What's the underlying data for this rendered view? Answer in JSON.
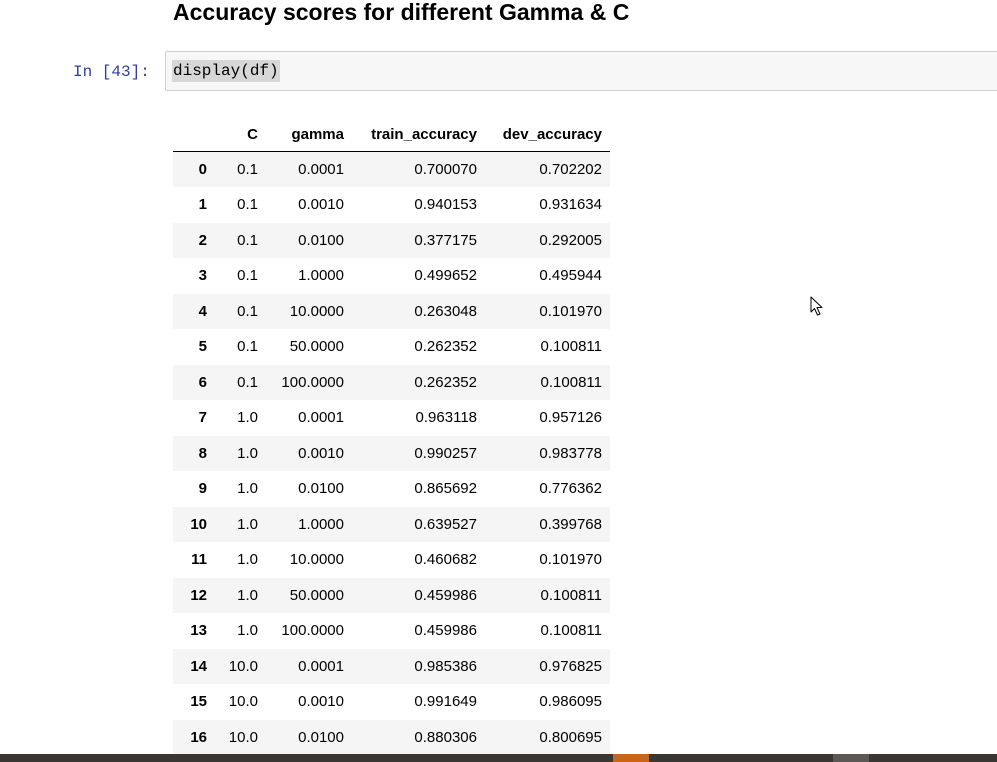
{
  "notebook": {
    "heading": "Accuracy scores for different Gamma & C",
    "cell": {
      "prompt": "In [43]:",
      "code": "display(df)"
    }
  },
  "table": {
    "columns": [
      "",
      "C",
      "gamma",
      "train_accuracy",
      "dev_accuracy"
    ],
    "rows": [
      {
        "index": "0",
        "C": "0.1",
        "gamma": "0.0001",
        "train_accuracy": "0.700070",
        "dev_accuracy": "0.702202"
      },
      {
        "index": "1",
        "C": "0.1",
        "gamma": "0.0010",
        "train_accuracy": "0.940153",
        "dev_accuracy": "0.931634"
      },
      {
        "index": "2",
        "C": "0.1",
        "gamma": "0.0100",
        "train_accuracy": "0.377175",
        "dev_accuracy": "0.292005"
      },
      {
        "index": "3",
        "C": "0.1",
        "gamma": "1.0000",
        "train_accuracy": "0.499652",
        "dev_accuracy": "0.495944"
      },
      {
        "index": "4",
        "C": "0.1",
        "gamma": "10.0000",
        "train_accuracy": "0.263048",
        "dev_accuracy": "0.101970"
      },
      {
        "index": "5",
        "C": "0.1",
        "gamma": "50.0000",
        "train_accuracy": "0.262352",
        "dev_accuracy": "0.100811"
      },
      {
        "index": "6",
        "C": "0.1",
        "gamma": "100.0000",
        "train_accuracy": "0.262352",
        "dev_accuracy": "0.100811"
      },
      {
        "index": "7",
        "C": "1.0",
        "gamma": "0.0001",
        "train_accuracy": "0.963118",
        "dev_accuracy": "0.957126"
      },
      {
        "index": "8",
        "C": "1.0",
        "gamma": "0.0010",
        "train_accuracy": "0.990257",
        "dev_accuracy": "0.983778"
      },
      {
        "index": "9",
        "C": "1.0",
        "gamma": "0.0100",
        "train_accuracy": "0.865692",
        "dev_accuracy": "0.776362"
      },
      {
        "index": "10",
        "C": "1.0",
        "gamma": "1.0000",
        "train_accuracy": "0.639527",
        "dev_accuracy": "0.399768"
      },
      {
        "index": "11",
        "C": "1.0",
        "gamma": "10.0000",
        "train_accuracy": "0.460682",
        "dev_accuracy": "0.101970"
      },
      {
        "index": "12",
        "C": "1.0",
        "gamma": "50.0000",
        "train_accuracy": "0.459986",
        "dev_accuracy": "0.100811"
      },
      {
        "index": "13",
        "C": "1.0",
        "gamma": "100.0000",
        "train_accuracy": "0.459986",
        "dev_accuracy": "0.100811"
      },
      {
        "index": "14",
        "C": "10.0",
        "gamma": "0.0001",
        "train_accuracy": "0.985386",
        "dev_accuracy": "0.976825"
      },
      {
        "index": "15",
        "C": "10.0",
        "gamma": "0.0010",
        "train_accuracy": "0.991649",
        "dev_accuracy": "0.986095"
      },
      {
        "index": "16",
        "C": "10.0",
        "gamma": "0.0100",
        "train_accuracy": "0.880306",
        "dev_accuracy": "0.800695"
      }
    ]
  },
  "icons": {
    "cursor": "mouse-pointer-icon"
  },
  "colors": {
    "prompt": "#303f9f",
    "input_bg": "#f7f7f7",
    "row_stripe": "#f5f5f5",
    "taskbar": "#3a3632",
    "taskbar_active": "#c8651b"
  }
}
